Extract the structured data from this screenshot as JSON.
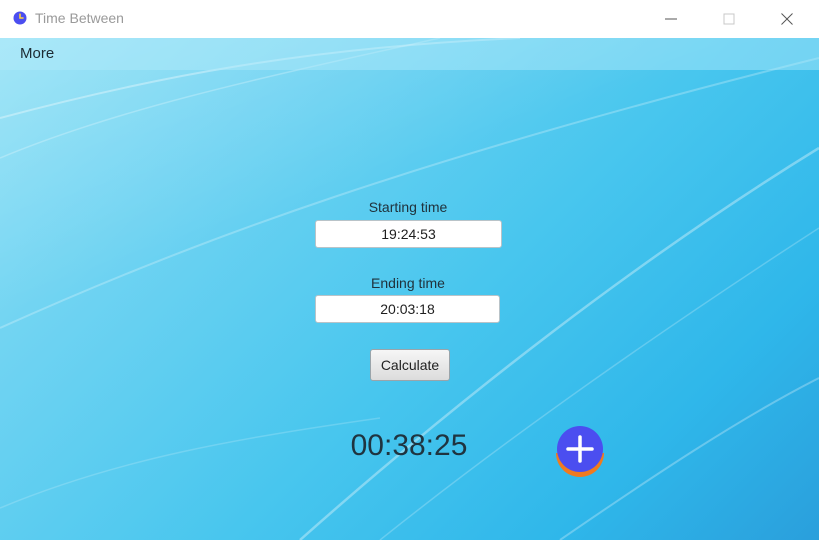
{
  "window": {
    "title": "Time Between",
    "controls": [
      "minimize",
      "maximize",
      "close"
    ]
  },
  "menu": {
    "items": [
      {
        "label": "More"
      }
    ]
  },
  "form": {
    "start_label": "Starting time",
    "start_value": "19:24:53",
    "end_label": "Ending time",
    "end_value": "20:03:18",
    "calculate_label": "Calculate"
  },
  "result": {
    "value": "00:38:25"
  },
  "icons": {
    "app": "clock-icon",
    "add": "plus-circle-icon"
  },
  "colors": {
    "background_start": "#8fe0f5",
    "background_end": "#2a9fdc",
    "add_button_fill": "#4b4ef0",
    "add_button_ring": "#f07a1f",
    "app_icon": "#4b4ef0"
  }
}
